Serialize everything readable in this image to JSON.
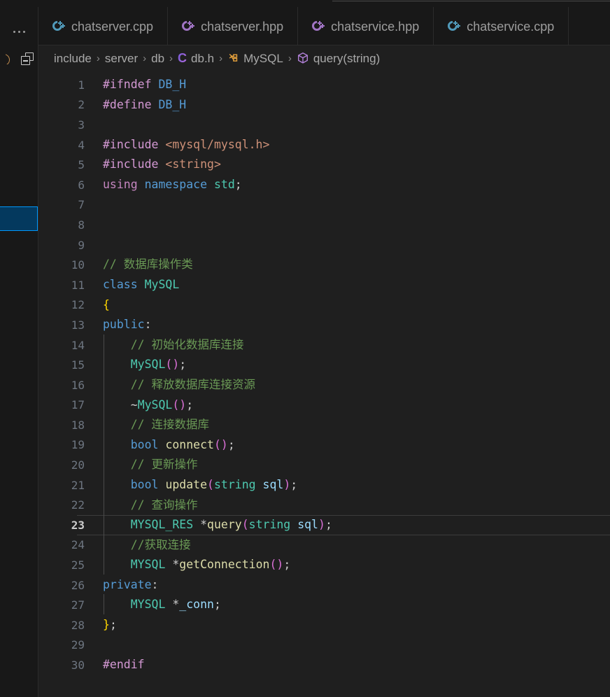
{
  "window": {
    "background": "#1f1f1f",
    "tabbar_background": "#181818",
    "accent": "#0097fb",
    "selection_fill": "#04395e"
  },
  "rail": {
    "more_actions_label": "…",
    "more_actions_icon": "ellipsis-icon",
    "circle_icon": "circle-outline-icon",
    "collapse_icon": "collapse-all-icon",
    "selected_item": {
      "name": "selected-explorer-item"
    }
  },
  "tabs": [
    {
      "label": "chatserver.cpp",
      "icon": "cpp-file-icon",
      "icon_color": "#519aba",
      "active": false
    },
    {
      "label": "chatserver.hpp",
      "icon": "cpp-file-icon",
      "icon_color": "#a074c4",
      "active": false
    },
    {
      "label": "chatservice.hpp",
      "icon": "cpp-file-icon",
      "icon_color": "#a074c4",
      "active": false
    },
    {
      "label": "chatservice.cpp",
      "icon": "cpp-file-icon",
      "icon_color": "#519aba",
      "active": false
    }
  ],
  "breadcrumb": {
    "separator": "›",
    "items": [
      {
        "label": "include",
        "icon": null
      },
      {
        "label": "server",
        "icon": null
      },
      {
        "label": "db",
        "icon": null
      },
      {
        "label": "db.h",
        "icon": "c-header-file-icon"
      },
      {
        "label": "MySQL",
        "icon": "class-symbol-icon"
      },
      {
        "label": "query(string)",
        "icon": "method-symbol-icon"
      }
    ]
  },
  "editor": {
    "active_line": 23,
    "first_line": 1,
    "last_line": 30,
    "lines": [
      {
        "n": 1,
        "indent": 0,
        "guide": false,
        "tokens": [
          {
            "t": "#ifndef",
            "c": "t-pre"
          },
          {
            "t": " ",
            "c": "t-op"
          },
          {
            "t": "DB_H",
            "c": "t-macro"
          }
        ]
      },
      {
        "n": 2,
        "indent": 0,
        "guide": false,
        "tokens": [
          {
            "t": "#define",
            "c": "t-pre"
          },
          {
            "t": " ",
            "c": "t-op"
          },
          {
            "t": "DB_H",
            "c": "t-macro"
          }
        ]
      },
      {
        "n": 3,
        "indent": 0,
        "guide": false,
        "tokens": []
      },
      {
        "n": 4,
        "indent": 0,
        "guide": false,
        "tokens": [
          {
            "t": "#include",
            "c": "t-pre"
          },
          {
            "t": " ",
            "c": "t-op"
          },
          {
            "t": "<mysql/mysql.h>",
            "c": "t-str"
          }
        ]
      },
      {
        "n": 5,
        "indent": 0,
        "guide": false,
        "tokens": [
          {
            "t": "#include",
            "c": "t-pre"
          },
          {
            "t": " ",
            "c": "t-op"
          },
          {
            "t": "<string>",
            "c": "t-str"
          }
        ]
      },
      {
        "n": 6,
        "indent": 0,
        "guide": false,
        "tokens": [
          {
            "t": "using",
            "c": "t-kw"
          },
          {
            "t": " ",
            "c": "t-op"
          },
          {
            "t": "namespace",
            "c": "t-kw2"
          },
          {
            "t": " ",
            "c": "t-op"
          },
          {
            "t": "std",
            "c": "t-type"
          },
          {
            "t": ";",
            "c": "t-op"
          }
        ]
      },
      {
        "n": 7,
        "indent": 0,
        "guide": false,
        "tokens": []
      },
      {
        "n": 8,
        "indent": 0,
        "guide": false,
        "tokens": []
      },
      {
        "n": 9,
        "indent": 0,
        "guide": false,
        "tokens": []
      },
      {
        "n": 10,
        "indent": 0,
        "guide": false,
        "tokens": [
          {
            "t": "// 数据库操作类",
            "c": "t-cmt"
          }
        ]
      },
      {
        "n": 11,
        "indent": 0,
        "guide": false,
        "tokens": [
          {
            "t": "class",
            "c": "t-kw2"
          },
          {
            "t": " ",
            "c": "t-op"
          },
          {
            "t": "MySQL",
            "c": "t-type"
          }
        ]
      },
      {
        "n": 12,
        "indent": 0,
        "guide": false,
        "tokens": [
          {
            "t": "{",
            "c": "t-brace"
          }
        ]
      },
      {
        "n": 13,
        "indent": 0,
        "guide": false,
        "tokens": [
          {
            "t": "public",
            "c": "t-kw2"
          },
          {
            "t": ":",
            "c": "t-op"
          }
        ]
      },
      {
        "n": 14,
        "indent": 4,
        "guide": true,
        "tokens": [
          {
            "t": "// 初始化数据库连接",
            "c": "t-cmt"
          }
        ]
      },
      {
        "n": 15,
        "indent": 4,
        "guide": true,
        "tokens": [
          {
            "t": "MySQL",
            "c": "t-type"
          },
          {
            "t": "(",
            "c": "t-paren"
          },
          {
            "t": ")",
            "c": "t-paren"
          },
          {
            "t": ";",
            "c": "t-op"
          }
        ]
      },
      {
        "n": 16,
        "indent": 4,
        "guide": true,
        "tokens": [
          {
            "t": "// 释放数据库连接资源",
            "c": "t-cmt"
          }
        ]
      },
      {
        "n": 17,
        "indent": 4,
        "guide": true,
        "tokens": [
          {
            "t": "~",
            "c": "t-op"
          },
          {
            "t": "MySQL",
            "c": "t-type"
          },
          {
            "t": "(",
            "c": "t-paren"
          },
          {
            "t": ")",
            "c": "t-paren"
          },
          {
            "t": ";",
            "c": "t-op"
          }
        ]
      },
      {
        "n": 18,
        "indent": 4,
        "guide": true,
        "tokens": [
          {
            "t": "// 连接数据库",
            "c": "t-cmt"
          }
        ]
      },
      {
        "n": 19,
        "indent": 4,
        "guide": true,
        "tokens": [
          {
            "t": "bool",
            "c": "t-kw2"
          },
          {
            "t": " ",
            "c": "t-op"
          },
          {
            "t": "connect",
            "c": "t-fn"
          },
          {
            "t": "(",
            "c": "t-paren"
          },
          {
            "t": ")",
            "c": "t-paren"
          },
          {
            "t": ";",
            "c": "t-op"
          }
        ]
      },
      {
        "n": 20,
        "indent": 4,
        "guide": true,
        "tokens": [
          {
            "t": "// 更新操作",
            "c": "t-cmt"
          }
        ]
      },
      {
        "n": 21,
        "indent": 4,
        "guide": true,
        "tokens": [
          {
            "t": "bool",
            "c": "t-kw2"
          },
          {
            "t": " ",
            "c": "t-op"
          },
          {
            "t": "update",
            "c": "t-fn"
          },
          {
            "t": "(",
            "c": "t-paren"
          },
          {
            "t": "string",
            "c": "t-type"
          },
          {
            "t": " ",
            "c": "t-op"
          },
          {
            "t": "sql",
            "c": "t-var"
          },
          {
            "t": ")",
            "c": "t-paren"
          },
          {
            "t": ";",
            "c": "t-op"
          }
        ]
      },
      {
        "n": 22,
        "indent": 4,
        "guide": true,
        "tokens": [
          {
            "t": "// 查询操作",
            "c": "t-cmt"
          }
        ]
      },
      {
        "n": 23,
        "indent": 4,
        "guide": true,
        "tokens": [
          {
            "t": "MYSQL_RES",
            "c": "t-type"
          },
          {
            "t": " *",
            "c": "t-op"
          },
          {
            "t": "query",
            "c": "t-fn"
          },
          {
            "t": "(",
            "c": "t-paren"
          },
          {
            "t": "string",
            "c": "t-type"
          },
          {
            "t": " ",
            "c": "t-op"
          },
          {
            "t": "sql",
            "c": "t-var"
          },
          {
            "t": ")",
            "c": "t-paren"
          },
          {
            "t": ";",
            "c": "t-op"
          }
        ]
      },
      {
        "n": 24,
        "indent": 4,
        "guide": true,
        "tokens": [
          {
            "t": "//获取连接",
            "c": "t-cmt"
          }
        ]
      },
      {
        "n": 25,
        "indent": 4,
        "guide": true,
        "tokens": [
          {
            "t": "MYSQL",
            "c": "t-type"
          },
          {
            "t": " *",
            "c": "t-op"
          },
          {
            "t": "getConnection",
            "c": "t-fn"
          },
          {
            "t": "(",
            "c": "t-paren"
          },
          {
            "t": ")",
            "c": "t-paren"
          },
          {
            "t": ";",
            "c": "t-op"
          }
        ]
      },
      {
        "n": 26,
        "indent": 0,
        "guide": false,
        "tokens": [
          {
            "t": "private",
            "c": "t-kw2"
          },
          {
            "t": ":",
            "c": "t-op"
          }
        ]
      },
      {
        "n": 27,
        "indent": 4,
        "guide": true,
        "tokens": [
          {
            "t": "MYSQL",
            "c": "t-type"
          },
          {
            "t": " *",
            "c": "t-op"
          },
          {
            "t": "_conn",
            "c": "t-var"
          },
          {
            "t": ";",
            "c": "t-op"
          }
        ]
      },
      {
        "n": 28,
        "indent": 0,
        "guide": false,
        "tokens": [
          {
            "t": "}",
            "c": "t-brace"
          },
          {
            "t": ";",
            "c": "t-op"
          }
        ]
      },
      {
        "n": 29,
        "indent": 0,
        "guide": false,
        "tokens": []
      },
      {
        "n": 30,
        "indent": 0,
        "guide": false,
        "tokens": [
          {
            "t": "#endif",
            "c": "t-pre"
          }
        ]
      }
    ]
  }
}
